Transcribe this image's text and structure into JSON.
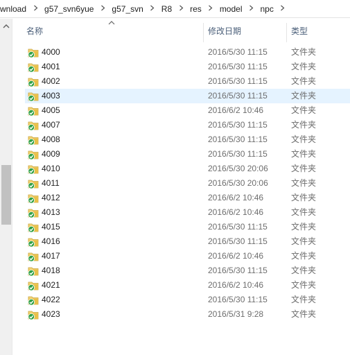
{
  "breadcrumb": [
    "wnload",
    "g57_svn6yue",
    "g57_svn",
    "R8",
    "res",
    "model",
    "npc"
  ],
  "columns": {
    "name": "名称",
    "date": "修改日期",
    "type": "类型"
  },
  "rows": [
    {
      "name": "4000",
      "date": "2016/5/30 11:15",
      "type": "文件夹"
    },
    {
      "name": "4001",
      "date": "2016/5/30 11:15",
      "type": "文件夹"
    },
    {
      "name": "4002",
      "date": "2016/5/30 11:15",
      "type": "文件夹"
    },
    {
      "name": "4003",
      "date": "2016/5/30 11:15",
      "type": "文件夹"
    },
    {
      "name": "4005",
      "date": "2016/6/2 10:46",
      "type": "文件夹"
    },
    {
      "name": "4007",
      "date": "2016/5/30 11:15",
      "type": "文件夹"
    },
    {
      "name": "4008",
      "date": "2016/5/30 11:15",
      "type": "文件夹"
    },
    {
      "name": "4009",
      "date": "2016/5/30 11:15",
      "type": "文件夹"
    },
    {
      "name": "4010",
      "date": "2016/5/30 20:06",
      "type": "文件夹"
    },
    {
      "name": "4011",
      "date": "2016/5/30 20:06",
      "type": "文件夹"
    },
    {
      "name": "4012",
      "date": "2016/6/2 10:46",
      "type": "文件夹"
    },
    {
      "name": "4013",
      "date": "2016/6/2 10:46",
      "type": "文件夹"
    },
    {
      "name": "4015",
      "date": "2016/5/30 11:15",
      "type": "文件夹"
    },
    {
      "name": "4016",
      "date": "2016/5/30 11:15",
      "type": "文件夹"
    },
    {
      "name": "4017",
      "date": "2016/6/2 10:46",
      "type": "文件夹"
    },
    {
      "name": "4018",
      "date": "2016/5/30 11:15",
      "type": "文件夹"
    },
    {
      "name": "4021",
      "date": "2016/6/2 10:46",
      "type": "文件夹"
    },
    {
      "name": "4022",
      "date": "2016/5/30 11:15",
      "type": "文件夹"
    },
    {
      "name": "4023",
      "date": "2016/5/31 9:28",
      "type": "文件夹"
    }
  ],
  "selected_row": "4003",
  "icons": {
    "folder": "svn-folder-checked-icon",
    "sort": "sort-ascending-icon"
  },
  "colors": {
    "selected": "#e5f3ff",
    "header_text": "#4c607a",
    "svn_check": "#2fa044",
    "folder": "#e8c04a"
  }
}
